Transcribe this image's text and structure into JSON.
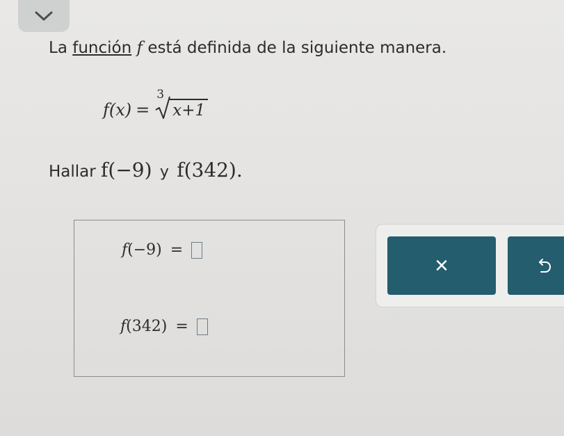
{
  "problem": {
    "intro_before": "La",
    "link_label": "función",
    "function_symbol": "f",
    "intro_after": "está definida de la siguiente manera."
  },
  "definition": {
    "lhs": "f(x)",
    "equals": "=",
    "root_index": "3",
    "radicand": "x+1"
  },
  "task": {
    "label": "Hallar",
    "first": "f(−9)",
    "conjunction": "y",
    "second": "f(342)."
  },
  "answers": [
    {
      "f": "f",
      "arg": "(−9)",
      "equals": "=",
      "value": ""
    },
    {
      "f": "f",
      "arg": "(342)",
      "equals": "=",
      "value": ""
    }
  ],
  "controls": {
    "clear_symbol": "×",
    "undo_icon": "undo-icon",
    "accent_color": "#235d6e"
  },
  "icons": {
    "collapse": "chevron-down-icon"
  }
}
